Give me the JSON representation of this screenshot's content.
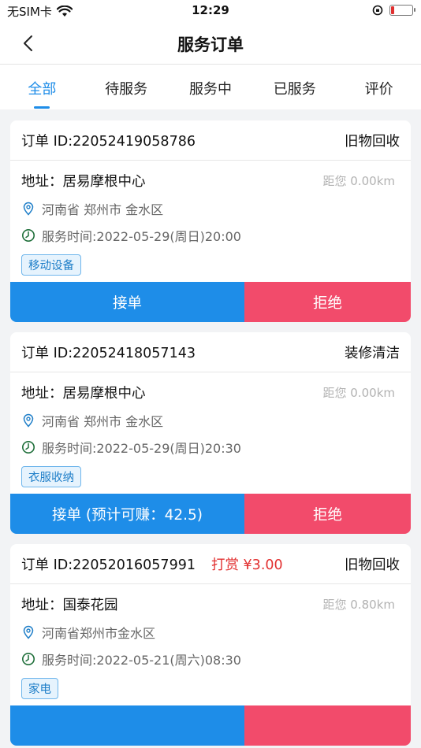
{
  "status": {
    "carrier": "无SIM卡",
    "time": "12:29"
  },
  "nav": {
    "title": "服务订单"
  },
  "tabs": [
    {
      "label": "全部",
      "active": true
    },
    {
      "label": "待服务",
      "active": false
    },
    {
      "label": "服务中",
      "active": false
    },
    {
      "label": "已服务",
      "active": false
    },
    {
      "label": "评价",
      "active": false
    }
  ],
  "orders": [
    {
      "order_id": "订单 ID:22052419058786",
      "reward": "",
      "category": "旧物回收",
      "address": "地址：居易摩根中心",
      "distance": "距您 0.00km",
      "region": "河南省 郑州市 金水区",
      "service_time": "服务时间:2022-05-29(周日)20:00",
      "tag": "移动设备",
      "accept_label": "接单",
      "reject_label": "拒绝"
    },
    {
      "order_id": "订单 ID:22052418057143",
      "reward": "",
      "category": "装修清洁",
      "address": "地址：居易摩根中心",
      "distance": "距您 0.00km",
      "region": "河南省 郑州市 金水区",
      "service_time": "服务时间:2022-05-29(周日)20:30",
      "tag": "衣服收纳",
      "accept_label": "接单 (预计可赚：42.5)",
      "reject_label": "拒绝"
    },
    {
      "order_id": "订单 ID:22052016057991",
      "reward": "打赏 ¥3.00",
      "category": "旧物回收",
      "address": "地址：国泰花园",
      "distance": "距您 0.80km",
      "region": "河南省郑州市金水区",
      "service_time": "服务时间:2022-05-21(周六)08:30",
      "tag": "家电",
      "accept_label": "",
      "reject_label": ""
    }
  ]
}
